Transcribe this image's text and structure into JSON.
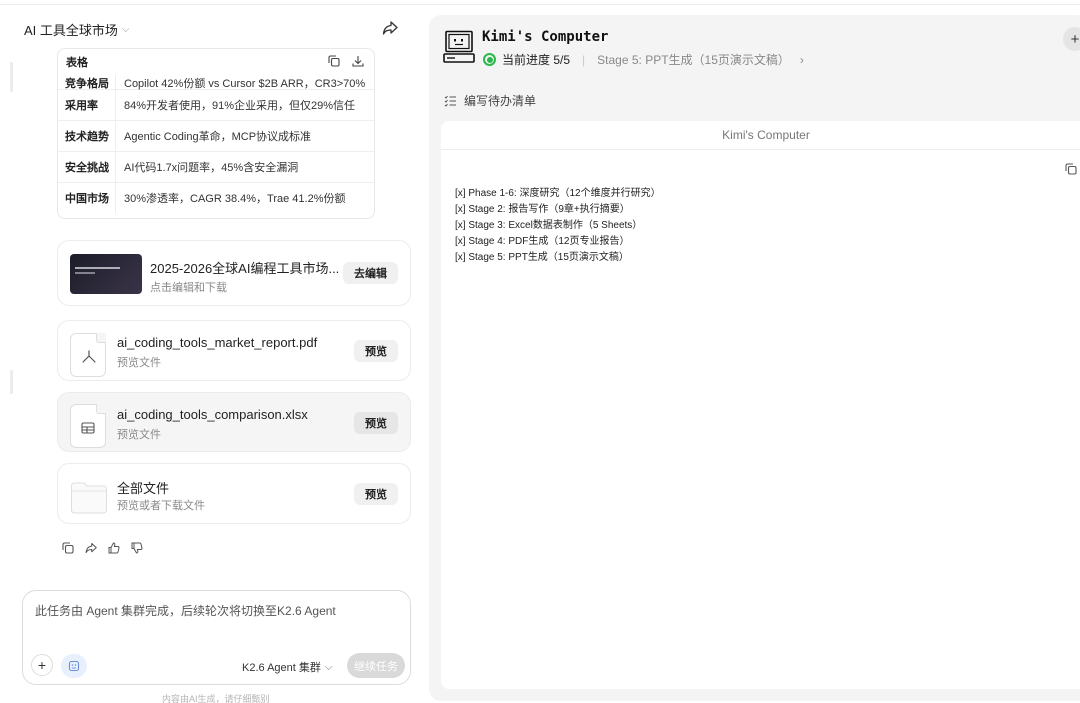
{
  "left": {
    "conversation_title": "AI 工具全球市场",
    "table": {
      "heading": "表格",
      "rows": [
        {
          "key": "竞争格局",
          "value": "Copilot 42%份额 vs Cursor $2B ARR，CR3>70%"
        },
        {
          "key": "采用率",
          "value": "84%开发者使用，91%企业采用，但仅29%信任"
        },
        {
          "key": "技术趋势",
          "value": "Agentic Coding革命，MCP协议成标准"
        },
        {
          "key": "安全挑战",
          "value": "AI代码1.7x问题率，45%含安全漏洞"
        },
        {
          "key": "中国市场",
          "value": "30%渗透率，CAGR 38.4%，Trae 41.2%份额"
        }
      ]
    },
    "ppt_card": {
      "name": "2025-2026全球AI编程工具市场...",
      "sub": "点击编辑和下载",
      "button": "去编辑"
    },
    "files": [
      {
        "name": "ai_coding_tools_market_report.pdf",
        "sub": "预览文件",
        "button": "预览"
      },
      {
        "name": "ai_coding_tools_comparison.xlsx",
        "sub": "预览文件",
        "button": "预览"
      },
      {
        "name": "全部文件",
        "sub": "预览或者下载文件",
        "button": "预览"
      }
    ],
    "input": {
      "placeholder": "此任务由 Agent 集群完成，后续轮次将切换至K2.6 Agent",
      "model": "K2.6 Agent 集群",
      "continue": "继续任务"
    },
    "disclaimer": "内容由AI生成，请仔细甄别"
  },
  "right": {
    "title": "Kimi's Computer",
    "progress": "当前进度 5/5",
    "stage": "Stage 5: PPT生成（15页演示文稿）",
    "todo_label": "编写待办清单",
    "screen_title": "Kimi's Computer",
    "todos": [
      "[x] Phase 1-6: 深度研究（12个维度并行研究）",
      "[x] Stage 2: 报告写作（9章+执行摘要）",
      "[x] Stage 3: Excel数据表制作（5 Sheets）",
      "[x] Stage 4: PDF生成（12页专业报告）",
      "[x] Stage 5: PPT生成（15页演示文稿）"
    ]
  }
}
